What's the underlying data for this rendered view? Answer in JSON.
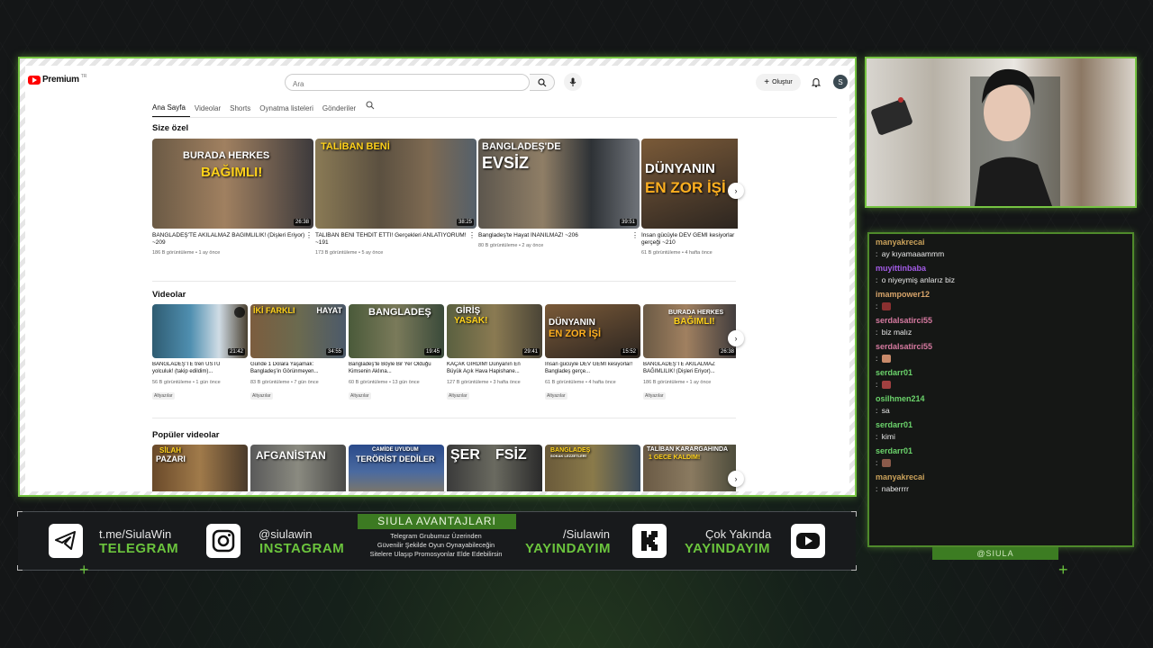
{
  "youtube": {
    "logo_text": "Premium",
    "logo_region": "TR",
    "search_placeholder": "Ara",
    "create_label": "Oluştur",
    "avatar_letter": "S",
    "tabs": [
      "Ana Sayfa",
      "Videolar",
      "Shorts",
      "Oynatma listeleri",
      "Gönderiler"
    ],
    "sections": {
      "for_you": "Size özel",
      "videos": "Videolar",
      "popular": "Popüler videolar"
    },
    "for_you_videos": [
      {
        "thumb_top": "BURADA HERKES",
        "thumb_bottom": "BAĞIMLI!",
        "duration": "26:38",
        "title": "BANGLADEŞ'TE AKILALMAZ BAĞIMLILIK! (Dişleri Eriyor) ~209",
        "views": "186 B görüntüleme",
        "age": "1 ay önce"
      },
      {
        "thumb_top": "TALİBAN BENİ",
        "thumb_bottom": "",
        "duration": "38:25",
        "title": "TALİBAN BENİ TEHDİT ETTİ! Gerçekleri ANLATIYORUM! ~191",
        "views": "173 B görüntüleme",
        "age": "5 ay önce"
      },
      {
        "thumb_top": "BANGLADEŞ'DE",
        "thumb_bottom": "EVSİZ",
        "duration": "39:51",
        "title": "Bangladeş'te Hayat İNANILMAZ! ~206",
        "views": "80 B görüntüleme",
        "age": "2 ay önce"
      },
      {
        "thumb_top": "DÜNYANIN",
        "thumb_bottom": "EN ZOR İŞİ",
        "duration": "",
        "title": "İnsan gücüyle DEV GEMİ kesiyorlar gerçeği ~210",
        "views": "61 B görüntüleme",
        "age": "4 hafta önce"
      }
    ],
    "video_list": [
      {
        "thumb_top": "",
        "thumb_bottom": "",
        "duration": "21:42",
        "title": "BANGLADEŞ'TE tren ÜSTÜ yolculuk! (takip edildim)...",
        "views": "56 B görüntüleme",
        "age": "1 gün önce",
        "badge": "Altyazılar"
      },
      {
        "thumb_top": "İKİ FARKLI",
        "thumb_bottom": "HAYAT",
        "duration": "34:55",
        "title": "Günde 1 Dolara Yaşamak: Bangladeş'in Görünmeyen...",
        "views": "83 B görüntüleme",
        "age": "7 gün önce",
        "badge": "Altyazılar"
      },
      {
        "thumb_top": "BANGLADEŞ",
        "thumb_bottom": "",
        "duration": "19:45",
        "title": "Bangladeş'te Böyle Bir Yer Olduğu Kimsenin Aklına...",
        "views": "60 B görüntüleme",
        "age": "13 gün önce",
        "badge": "Altyazılar"
      },
      {
        "thumb_top": "GİRİŞ",
        "thumb_bottom": "YASAK!",
        "duration": "29:41",
        "title": "KAÇAK GİRDİM! Dünyanın En Büyük Açık Hava Hapishane...",
        "views": "127 B görüntüleme",
        "age": "3 hafta önce",
        "badge": "Altyazılar"
      },
      {
        "thumb_top": "DÜNYANIN",
        "thumb_bottom": "EN ZOR İŞİ",
        "duration": "15:52",
        "title": "İnsan gücüyle DEV GEMİ kesiyorlar! Bangladeş gerçe...",
        "views": "61 B görüntüleme",
        "age": "4 hafta önce",
        "badge": "Altyazılar"
      },
      {
        "thumb_top": "BURADA HERKES",
        "thumb_bottom": "BAĞIMLI!",
        "duration": "26:38",
        "title": "BANGLADEŞ'TE AKILALMAZ BAĞIMLILIK! (Dişleri Eriyor)...",
        "views": "186 B görüntüleme",
        "age": "1 ay önce",
        "badge": "Altyazılar"
      }
    ],
    "popular_videos": [
      {
        "thumb_top": "SİLAH",
        "thumb_bottom": "PAZARI"
      },
      {
        "thumb_top": "AFGANİSTAN",
        "thumb_bottom": ""
      },
      {
        "thumb_top": "CAMİDE UYUDUM",
        "thumb_bottom": "TERÖRİST DEDİLER"
      },
      {
        "thumb_top": "ŞER",
        "thumb_bottom": "FSİZ"
      },
      {
        "thumb_top": "BANGLADEŞ",
        "thumb_bottom": "SOKAK LEZZETLERİ"
      },
      {
        "thumb_top": "TALİBAN KARARGAHINDA",
        "thumb_bottom": "1 GECE KALDIM!"
      }
    ]
  },
  "chat": {
    "messages": [
      {
        "user": "manyakrecai",
        "text": "ay kıyamaaammm",
        "color": "#c9a15a",
        "emote": false
      },
      {
        "user": "muyittinbaba",
        "text": "o niyeymiş anlarız biz",
        "color": "#a35be6",
        "emote": false
      },
      {
        "user": "imampower12",
        "text": "",
        "color": "#d7a46a",
        "emote": true
      },
      {
        "user": "serdalsatirci55",
        "text": "biz malız",
        "color": "#d67aa0",
        "emote": false
      },
      {
        "user": "serdalsatirci55",
        "text": "",
        "color": "#d67aa0",
        "emote": true
      },
      {
        "user": "serdarr01",
        "text": "",
        "color": "#6bd36b",
        "emote": true
      },
      {
        "user": "osilhmen214",
        "text": "sa",
        "color": "#6bd36b",
        "emote": false
      },
      {
        "user": "serdarr01",
        "text": "kimi",
        "color": "#6bd36b",
        "emote": false
      },
      {
        "user": "serdarr01",
        "text": "",
        "color": "#6bd36b",
        "emote": true
      },
      {
        "user": "manyakrecai",
        "text": "naberrrr",
        "color": "#c9a15a",
        "emote": false
      }
    ],
    "handle": "@SIULA"
  },
  "footer": {
    "telegram_top": "t.me/SiulaWin",
    "telegram_bottom": "TELEGRAM",
    "instagram_top": "@siulawin",
    "instagram_bottom": "INSTAGRAM",
    "avantaj_title": "SIULA AVANTAJLARI",
    "avantaj_line1": "Telegram Grubumuz Üzerinden",
    "avantaj_line2": "Güvenilir Şekilde Oyun Oynayabileceğin",
    "avantaj_line3": "Sitelere Ulaşıp Promosyonlar Elde Edebilirsin",
    "kick_top": "/Siulawin",
    "kick_bottom": "YAYINDAYIM",
    "youtube_top": "Çok Yakında",
    "youtube_bottom": "YAYINDAYIM"
  },
  "colors": {
    "accent_green": "#6bc43d",
    "youtube_red": "#ff0000"
  }
}
